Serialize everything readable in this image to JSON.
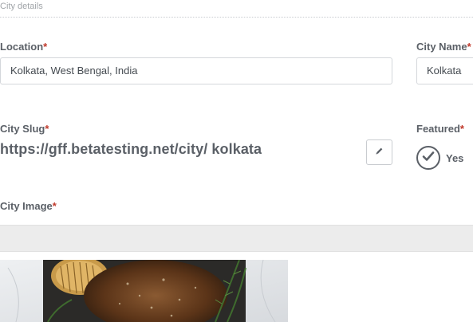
{
  "section": {
    "title": "City details"
  },
  "location": {
    "label": "Location",
    "required_mark": "*",
    "value": "Kolkata, West Bengal, India"
  },
  "city_name": {
    "label": "City Name",
    "required_mark": "*",
    "value": "Kolkata"
  },
  "city_slug": {
    "label": "City Slug",
    "required_mark": "*",
    "value": "https://gff.betatesting.net/city/ kolkata",
    "edit_icon": "pencil-icon"
  },
  "featured": {
    "label": "Featured",
    "required_mark": "*",
    "option_label": "Yes",
    "checked": true,
    "icon": "check-circle-icon"
  },
  "city_image": {
    "label": "City Image",
    "required_mark": "*"
  },
  "colors": {
    "required": "#c0392b",
    "label": "#5b6067",
    "upload_bar": "#ececec"
  }
}
